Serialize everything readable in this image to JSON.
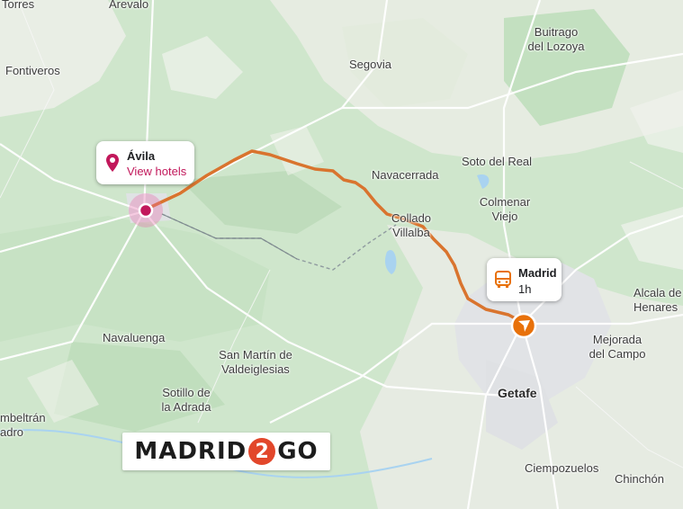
{
  "places": {
    "torres": "Torres",
    "arevalo": "Arevalo",
    "fontiveros": "Fontiveros",
    "segovia": "Segovia",
    "buitrago": "Buitrago\ndel Lozoya",
    "navacerrada": "Navacerrada",
    "soto_del_real": "Soto del Real",
    "colmenar_viejo": "Colmenar\nViejo",
    "collado_villalba": "Collado\nVillalba",
    "alcala": "Alcala de\nHenares",
    "navaluenga": "Navaluenga",
    "san_martin": "San Martín de\nValdeiglesias",
    "mejorada": "Mejorada\ndel Campo",
    "sotillo": "Sotillo de\nla Adrada",
    "getafe": "Getafe",
    "cadalso": "mbeltrán\nadro",
    "ciempozuelos": "Ciempozuelos",
    "chinchon": "Chinchón"
  },
  "origin_callout": {
    "name": "Ávila",
    "link_label": "View hotels",
    "icon": "location-pin-icon",
    "accent": "#c2185b"
  },
  "destination_callout": {
    "name": "Madrid",
    "duration": "1h",
    "icon": "bus-icon",
    "accent": "#e8710a"
  },
  "route": {
    "color": "#d9742e",
    "from": "Ávila",
    "to": "Madrid"
  },
  "logo": {
    "text_left": "MADRID",
    "badge": "2",
    "text_right": "GO",
    "badge_color": "#e2472b"
  }
}
